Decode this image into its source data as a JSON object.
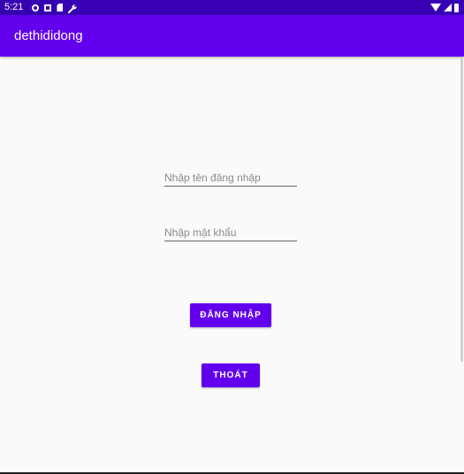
{
  "status_bar": {
    "time": "5:21",
    "left_icons": [
      "gear-icon",
      "a-box-icon",
      "sd-card-icon",
      "wrench-icon"
    ],
    "right_icons": [
      "wifi-icon",
      "signal-icon",
      "battery-icon"
    ]
  },
  "app_bar": {
    "title": "dethididong"
  },
  "form": {
    "username_placeholder": "Nhập tên đăng nhập",
    "username_value": "",
    "password_placeholder": "Nhập mật khẩu",
    "password_value": ""
  },
  "buttons": {
    "login_label": "ĐĂNG NHẬP",
    "exit_label": "THOÁT"
  },
  "colors": {
    "status_bar": "#3700b3",
    "primary": "#6200ee",
    "background": "#fafafa"
  }
}
